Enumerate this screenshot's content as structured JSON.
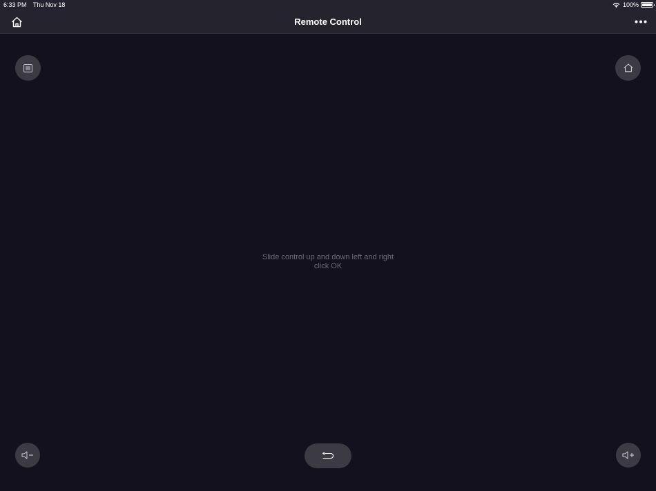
{
  "status_bar": {
    "time": "6:33 PM",
    "date": "Thu Nov 18",
    "battery_percent": "100%",
    "icons": [
      "wifi-icon",
      "battery-icon"
    ]
  },
  "nav_bar": {
    "title": "Remote Control",
    "left_icon": "home-icon",
    "right_icon": "more-dots-icon"
  },
  "controls": {
    "menu_icon": "menu-list-icon",
    "home_icon": "home-icon",
    "volume_down_icon": "volume-down-icon",
    "volume_up_icon": "volume-up-icon",
    "back_icon": "return-arrow-icon"
  },
  "touchpad": {
    "hint_line1": "Slide control up and down left and right",
    "hint_line2": "click OK"
  },
  "colors": {
    "background": "#12111d",
    "bar": "#25242e",
    "button": "#3c3b43",
    "hint_text": "#6b6a73"
  }
}
